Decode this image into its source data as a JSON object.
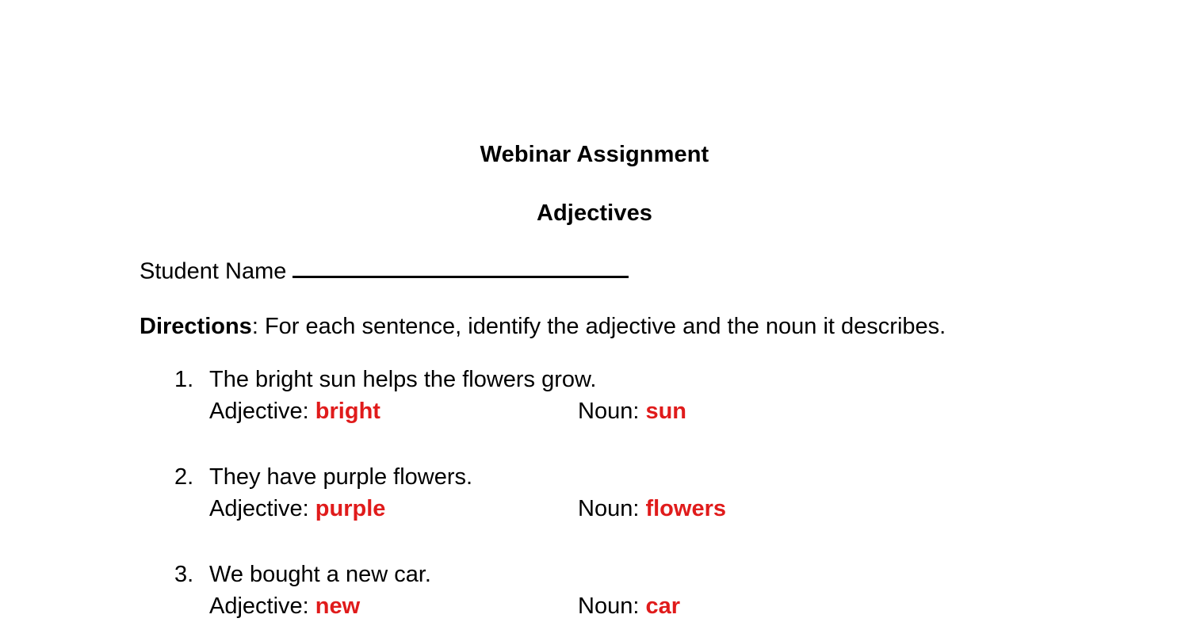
{
  "document": {
    "title": "Webinar Assignment",
    "subtitle": "Adjectives",
    "student_name_label": "Student Name",
    "student_name_value": "",
    "directions_lead": "Directions",
    "directions_text": ": For each sentence, identify the adjective and the noun it describes.",
    "labels": {
      "adjective": "Adjective:",
      "noun": "Noun:"
    },
    "answer_color": "#e01b1b",
    "questions": [
      {
        "number": "1.",
        "sentence": "The bright sun helps the flowers grow.",
        "adjective": "bright",
        "noun": "sun"
      },
      {
        "number": "2.",
        "sentence": "They have purple flowers.",
        "adjective": "purple",
        "noun": "flowers"
      },
      {
        "number": "3.",
        "sentence": "We bought a new car.",
        "adjective": "new",
        "noun": "car"
      }
    ]
  }
}
